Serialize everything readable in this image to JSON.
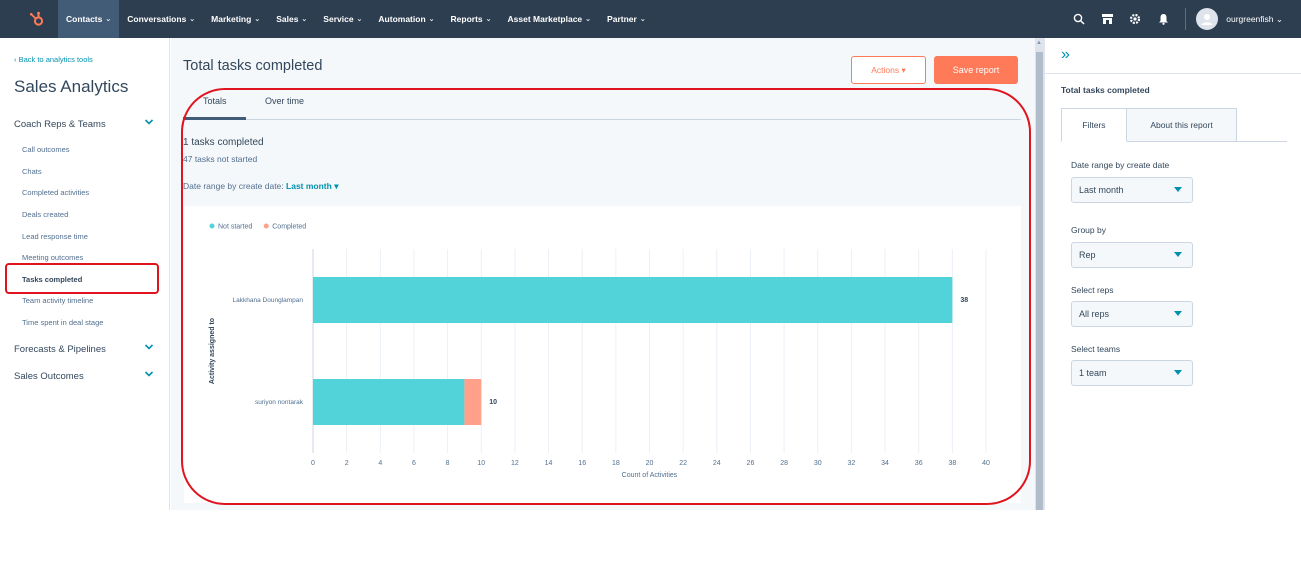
{
  "topnav": {
    "items": [
      {
        "label": "Contacts"
      },
      {
        "label": "Conversations"
      },
      {
        "label": "Marketing"
      },
      {
        "label": "Sales"
      },
      {
        "label": "Service"
      },
      {
        "label": "Automation"
      },
      {
        "label": "Reports"
      },
      {
        "label": "Asset Marketplace"
      },
      {
        "label": "Partner"
      }
    ],
    "account": "ourgreenfish",
    "brand_color": "#ff7a59",
    "bar_color": "#2d3e50"
  },
  "sidebar": {
    "back_link": "Back to analytics tools",
    "title": "Sales Analytics",
    "sections": [
      {
        "label": "Coach Reps & Teams"
      },
      {
        "label": "Forecasts & Pipelines"
      },
      {
        "label": "Sales Outcomes"
      }
    ],
    "items": [
      {
        "label": "Call outcomes"
      },
      {
        "label": "Chats"
      },
      {
        "label": "Completed activities"
      },
      {
        "label": "Deals created"
      },
      {
        "label": "Lead response time"
      },
      {
        "label": "Meeting outcomes"
      },
      {
        "label": "Tasks completed",
        "active": true
      },
      {
        "label": "Team activity timeline"
      },
      {
        "label": "Time spent in deal stage"
      }
    ]
  },
  "main": {
    "title": "Total tasks completed",
    "actions_label": "Actions",
    "save_label": "Save report",
    "tabs": [
      {
        "label": "Totals",
        "active": true
      },
      {
        "label": "Over time"
      }
    ],
    "stat_completed": "1 tasks completed",
    "stat_not_started": "47 tasks not started",
    "date_range_label": "Date range by create date:",
    "date_range_value": "Last month"
  },
  "chart_data": {
    "type": "bar",
    "orientation": "horizontal",
    "stacked": true,
    "categories": [
      "Lakkhana Dounglampan",
      "suriyon nontarak"
    ],
    "series": [
      {
        "name": "Not started",
        "color": "#51d3d9",
        "values": [
          38,
          9
        ]
      },
      {
        "name": "Completed",
        "color": "#ffa18a",
        "values": [
          0,
          1
        ]
      }
    ],
    "totals": [
      38,
      10
    ],
    "xlabel": "Count of Activities",
    "ylabel": "Activity assigned to",
    "xlim": [
      0,
      40
    ],
    "xticks": [
      0,
      2,
      4,
      6,
      8,
      10,
      12,
      14,
      16,
      18,
      20,
      22,
      24,
      26,
      28,
      30,
      32,
      34,
      36,
      38,
      40
    ],
    "grid": true,
    "legend": "top-left"
  },
  "rpanel": {
    "title": "Total tasks completed",
    "tabs": [
      {
        "label": "Filters"
      },
      {
        "label": "About this report"
      }
    ],
    "filters": [
      {
        "label": "Date range by create date",
        "value": "Last month"
      },
      {
        "label": "Group by",
        "value": "Rep"
      },
      {
        "label": "Select reps",
        "value": "All reps"
      },
      {
        "label": "Select teams",
        "value": "1 team"
      }
    ]
  }
}
